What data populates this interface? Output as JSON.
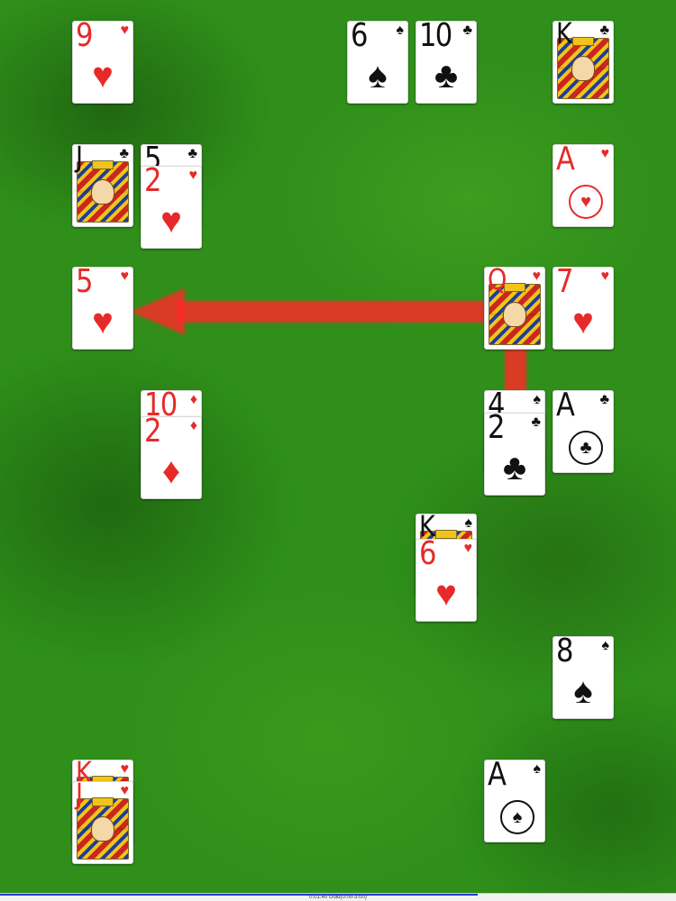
{
  "cards": [
    {
      "id": "9h",
      "rank": "9",
      "suit": "♥",
      "color": "red"
    },
    {
      "id": "6s",
      "rank": "6",
      "suit": "♠",
      "color": "black"
    },
    {
      "id": "10c",
      "rank": "10",
      "suit": "♣",
      "color": "black"
    },
    {
      "id": "kc",
      "rank": "K",
      "suit": "♣",
      "color": "black"
    },
    {
      "id": "jc",
      "rank": "J",
      "suit": "♣",
      "color": "black"
    },
    {
      "id": "5c",
      "rank": "5",
      "suit": "♣",
      "color": "black"
    },
    {
      "id": "2h",
      "rank": "2",
      "suit": "♥",
      "color": "red"
    },
    {
      "id": "ah",
      "rank": "A",
      "suit": "♥",
      "color": "red"
    },
    {
      "id": "5h",
      "rank": "5",
      "suit": "♥",
      "color": "red"
    },
    {
      "id": "qh",
      "rank": "Q",
      "suit": "♥",
      "color": "red"
    },
    {
      "id": "7h",
      "rank": "7",
      "suit": "♥",
      "color": "red"
    },
    {
      "id": "10d",
      "rank": "10",
      "suit": "♦",
      "color": "red"
    },
    {
      "id": "2d",
      "rank": "2",
      "suit": "♦",
      "color": "red"
    },
    {
      "id": "4s",
      "rank": "4",
      "suit": "♠",
      "color": "black"
    },
    {
      "id": "2c",
      "rank": "2",
      "suit": "♣",
      "color": "black"
    },
    {
      "id": "ac",
      "rank": "A",
      "suit": "♣",
      "color": "black"
    },
    {
      "id": "ks",
      "rank": "K",
      "suit": "♠",
      "color": "black"
    },
    {
      "id": "6h",
      "rank": "6",
      "suit": "♥",
      "color": "red"
    },
    {
      "id": "8s",
      "rank": "8",
      "suit": "♠",
      "color": "black"
    },
    {
      "id": "kh",
      "rank": "K",
      "suit": "♥",
      "color": "red"
    },
    {
      "id": "jh",
      "rank": "J",
      "suit": "♥",
      "color": "red"
    },
    {
      "id": "as",
      "rank": "A",
      "suit": "♠",
      "color": "black"
    }
  ],
  "hint_arrow": {
    "from": "2c",
    "to": "5h",
    "color": "#ff2828"
  },
  "status": {
    "text": "0:01:40 Gold(0:00-3:00)"
  },
  "colors": {
    "felt": "#2f8f1a",
    "arrow": "#ff2828"
  }
}
